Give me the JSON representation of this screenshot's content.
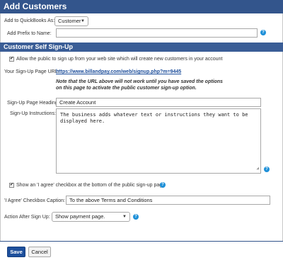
{
  "header": {
    "title": "Add Customers"
  },
  "form": {
    "qb_label": "Add to QuickBooks As:",
    "qb_value": "Customer",
    "prefix_label": "Add Prefix to Name:",
    "prefix_value": ""
  },
  "self_signup": {
    "title": "Customer Self Sign-Up",
    "allow_label": "Allow the public to sign up from your web site which will create new customers in your account",
    "allow_checked": true,
    "url_label": "Your Sign-Up Page URL:",
    "url_value": "https://www.billandpay.com/web/signup.php?m=9445",
    "note_line1": "Note that the URL above will not work until you have saved the options",
    "note_line2": "on this page to activate the public customer sign-up option.",
    "heading_label": "Sign-Up Page Heading:",
    "heading_value": "Create Account",
    "instructions_label": "Sign-Up Instructions:",
    "instructions_line1": "The business adds whatever text or instructions they want to be",
    "instructions_line2": "displayed here.",
    "agree_label": "Show an 'I agree' checkbox at the bottom of the public sign-up page",
    "agree_checked": true,
    "caption_label": "'I Agree' Checkbox Caption:",
    "caption_value": "To the above Terms and Conditions",
    "action_label": "Action After Sign Up:",
    "action_value": "Show payment page."
  },
  "footer": {
    "save_label": "Save",
    "cancel_label": "Cancel"
  },
  "icons": {
    "help": "question-circle-icon",
    "dropdown": "chevron-down-icon"
  },
  "colors": {
    "header": "#33558c",
    "help": "#1e90d8",
    "link": "#1a4c9a",
    "save": "#1d4f9c"
  }
}
